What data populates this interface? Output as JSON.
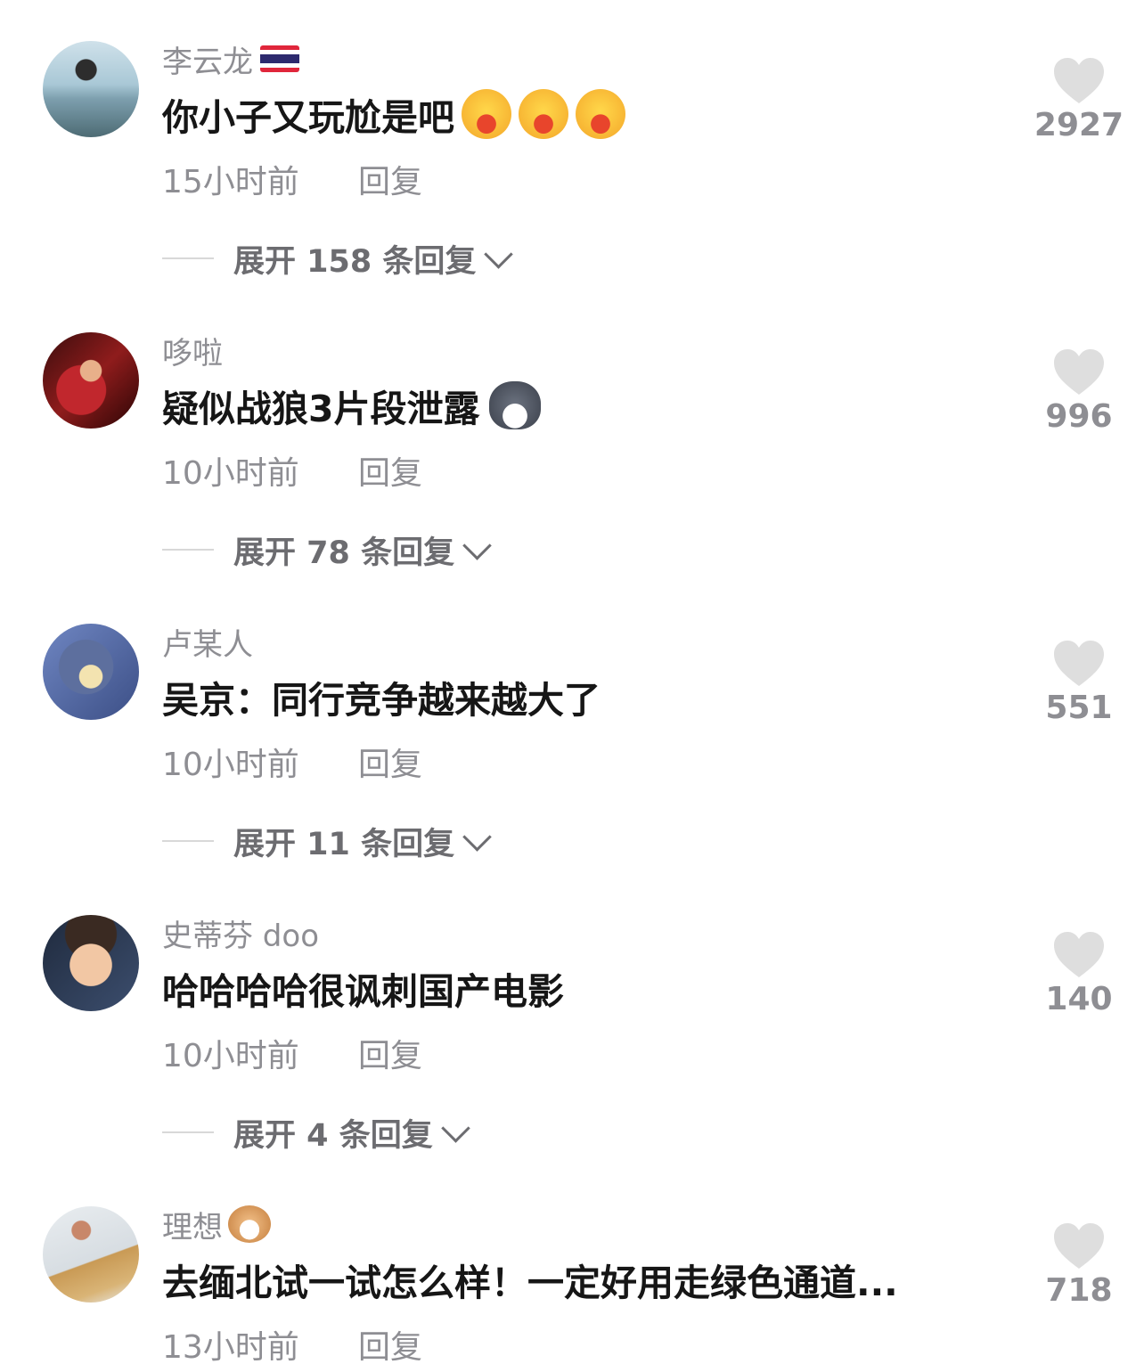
{
  "comments": [
    {
      "username": "李云龙",
      "text": "你小子又玩尬是吧",
      "time": "15小时前",
      "reply": "回复",
      "expand": "展开 158 条回复",
      "likes": "2927"
    },
    {
      "username": "哆啦",
      "text": "疑似战狼3片段泄露",
      "time": "10小时前",
      "reply": "回复",
      "expand": "展开 78 条回复",
      "likes": "996"
    },
    {
      "username": "卢某人",
      "text": "吴京：同行竞争越来越大了",
      "time": "10小时前",
      "reply": "回复",
      "expand": "展开 11 条回复",
      "likes": "551"
    },
    {
      "username": "史蒂芬 doo",
      "text": "哈哈哈哈很讽刺国产电影",
      "time": "10小时前",
      "reply": "回复",
      "expand": "展开 4 条回复",
      "likes": "140"
    },
    {
      "username": "理想",
      "text": "去缅北试一试怎么样！一定好用走绿色通道...",
      "time": "13小时前",
      "reply": "回复",
      "likes": "718"
    }
  ],
  "icons": {
    "like": "heart-icon",
    "expand": "chevron-down-icon"
  },
  "colors": {
    "heart": "#dedede",
    "text": "#161616",
    "muted": "#8e8e93"
  }
}
